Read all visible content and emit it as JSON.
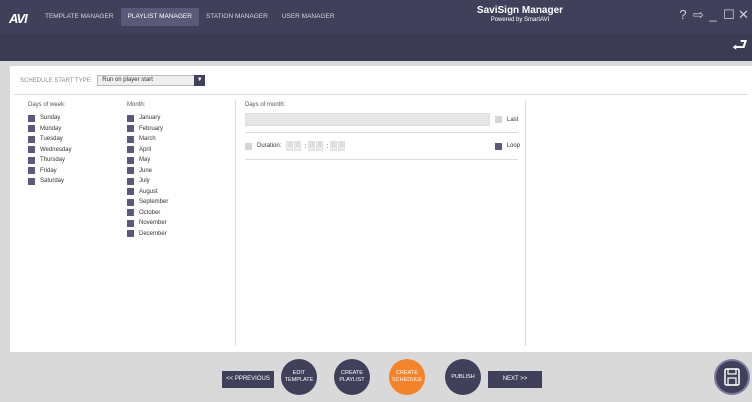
{
  "app": {
    "logo": "AVI",
    "title": "SaviSign Manager",
    "subtitle": "Powered by SmartAVI"
  },
  "tabs": [
    {
      "label": "TEMPLATE MANAGER"
    },
    {
      "label": "PLAYLIST MANAGER",
      "active": true
    },
    {
      "label": "STATION MANAGER"
    },
    {
      "label": "USER MANAGER"
    }
  ],
  "window_controls": {
    "help": "?",
    "logout": "⇨",
    "minimize": "_",
    "maximize": "☐",
    "close": "✕"
  },
  "back_icon": "back-arrow-icon",
  "schedule": {
    "start_type_label": "SCHEDULE START TYPE:",
    "start_type_value": "Run on player start",
    "days_title": "Days of week:",
    "days": [
      "Sunday",
      "Monday",
      "Tuesday",
      "Wednesday",
      "Thursday",
      "Friday",
      "Saturday"
    ],
    "months_title": "Month:",
    "months": [
      "January",
      "February",
      "March",
      "April",
      "May",
      "June",
      "July",
      "August",
      "September",
      "October",
      "November",
      "December"
    ],
    "dom_title": "Days of month:",
    "last_label": "Last",
    "duration_label": "Duration:",
    "duration_digits": [
      "0",
      "0",
      "0",
      "0",
      "0",
      "0"
    ],
    "loop_label": "Loop"
  },
  "wizard": {
    "previous": "<< PPREVIOUS",
    "next": "NEXT >>",
    "steps": [
      {
        "label": "EDIT TEMPLATE"
      },
      {
        "label": "CREATE PLAYLIST"
      },
      {
        "label": "CREATE SCHEDULE",
        "active": true
      },
      {
        "label": "PUBLISH"
      }
    ]
  },
  "colors": {
    "primary": "#40405a",
    "accent": "#f4842c",
    "panel": "#ffffff",
    "background": "#d9d9d9"
  }
}
